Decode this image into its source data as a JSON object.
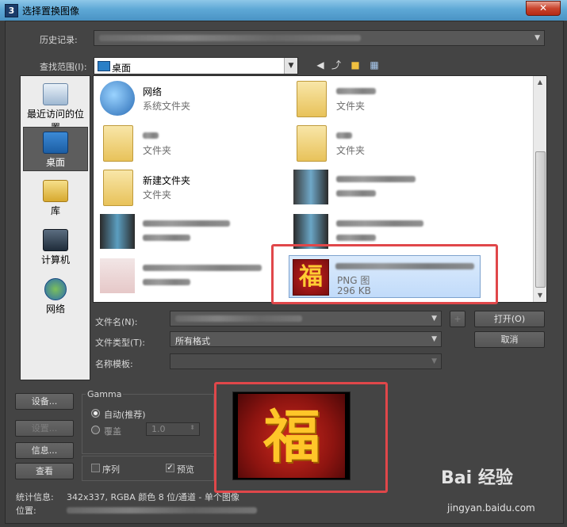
{
  "window": {
    "title": "选择置换图像",
    "app_icon": "3",
    "close_glyph": "✕"
  },
  "history": {
    "label": "历史记录:"
  },
  "lookin": {
    "label": "查找范围(I):",
    "value": "桌面"
  },
  "places": [
    {
      "label": "最近访问的位置",
      "icon": "recent-places-icon"
    },
    {
      "label": "桌面",
      "icon": "desktop-icon"
    },
    {
      "label": "库",
      "icon": "library-icon"
    },
    {
      "label": "计算机",
      "icon": "computer-icon"
    },
    {
      "label": "网络",
      "icon": "network-icon"
    }
  ],
  "files": [
    {
      "name": "网络",
      "type": "系统文件夹"
    },
    {
      "name": "",
      "type": "文件夹"
    },
    {
      "name": "",
      "type": "文件夹"
    },
    {
      "name": "",
      "type": "文件夹"
    },
    {
      "name": "新建文件夹",
      "type": "文件夹"
    },
    {
      "name": "",
      "type": ""
    },
    {
      "name": "",
      "type": ""
    },
    {
      "name": "",
      "type": ""
    },
    {
      "name": "",
      "type": ""
    },
    {
      "name": "",
      "type": "PNG 图",
      "size": "296 KB"
    }
  ],
  "form": {
    "filename_label": "文件名(N):",
    "filetype_label": "文件类型(T):",
    "filetype_value": "所有格式",
    "template_label": "名称模板:",
    "plus": "+",
    "open_button": "打开(O)",
    "cancel_button": "取消"
  },
  "side_buttons": {
    "setup": "设备...",
    "settings": "设置...",
    "info": "信息...",
    "view": "查看"
  },
  "gamma": {
    "title": "Gamma",
    "auto": "自动(推荐)",
    "override": "覆盖",
    "override_value": "1.0"
  },
  "options": {
    "sequence": "序列",
    "preview": "预览"
  },
  "status": {
    "stats_label": "统计信息:",
    "stats_value": "342x337, RGBA 颜色 8 位/通道 - 单个图像",
    "location_label": "位置:"
  },
  "watermark": {
    "main": "Bai 经验",
    "sub": "jingyan.baidu.com"
  }
}
